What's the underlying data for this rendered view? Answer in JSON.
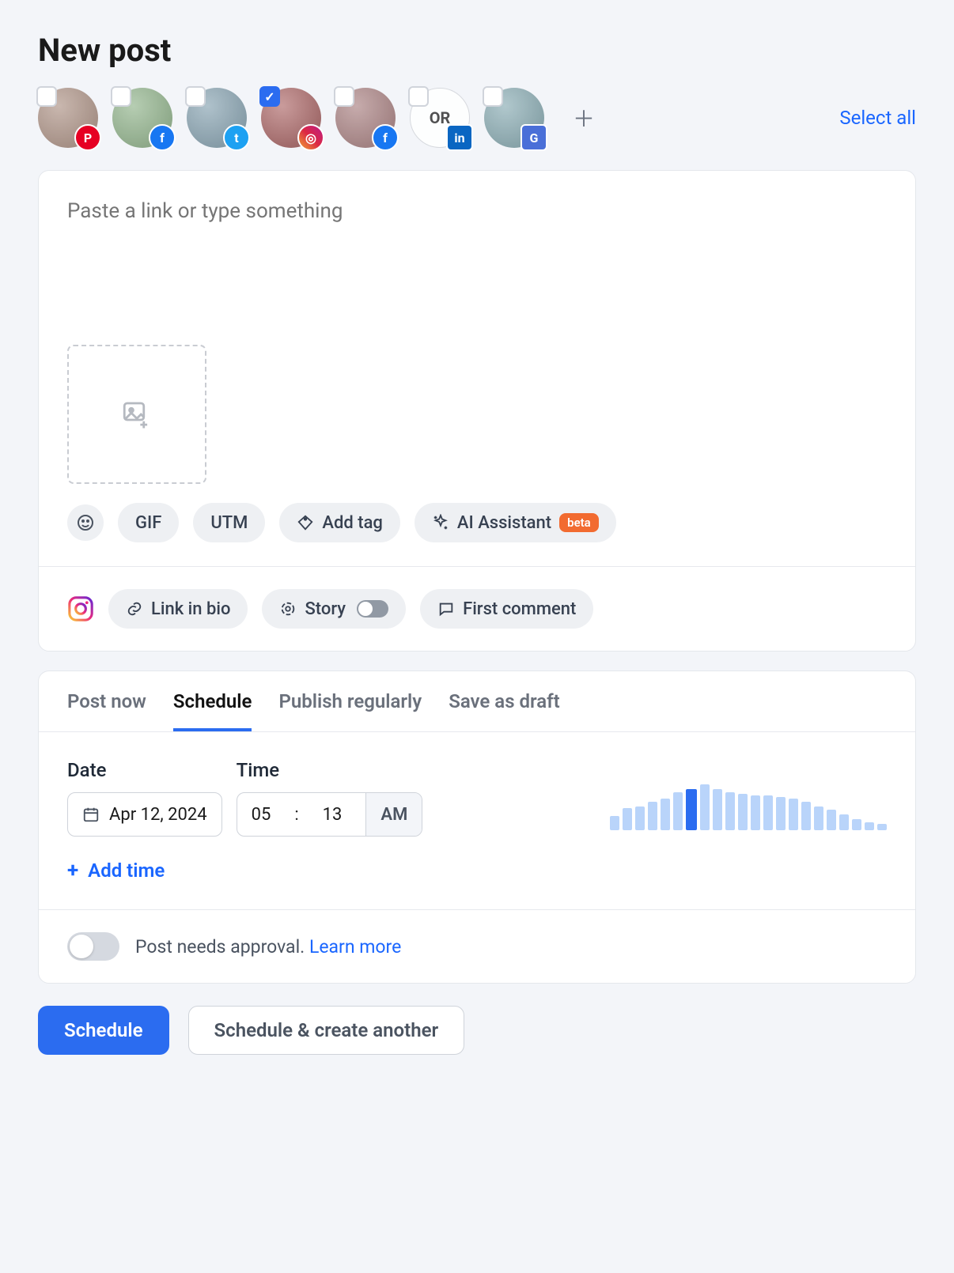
{
  "title": "New post",
  "select_all": "Select all",
  "accounts": [
    {
      "network": "pinterest",
      "checked": false,
      "avatar_hue": 20,
      "label": ""
    },
    {
      "network": "facebook",
      "checked": false,
      "avatar_hue": 110,
      "label": ""
    },
    {
      "network": "twitter",
      "checked": false,
      "avatar_hue": 200,
      "label": ""
    },
    {
      "network": "instagram",
      "checked": true,
      "avatar_hue": 0,
      "label": ""
    },
    {
      "network": "facebook",
      "checked": false,
      "avatar_hue": 0,
      "label": ""
    },
    {
      "network": "linkedin",
      "checked": false,
      "avatar_hue": 0,
      "label": "OR"
    },
    {
      "network": "google",
      "checked": false,
      "avatar_hue": 190,
      "label": ""
    }
  ],
  "composer": {
    "placeholder": "Paste a link or type something"
  },
  "toolbar": {
    "gif": "GIF",
    "utm": "UTM",
    "add_tag": "Add tag",
    "ai_assistant": "AI Assistant",
    "beta": "beta"
  },
  "ig_options": {
    "link_in_bio": "Link in bio",
    "story": "Story",
    "first_comment": "First comment"
  },
  "tabs": {
    "post_now": "Post now",
    "schedule": "Schedule",
    "publish_regularly": "Publish regularly",
    "save_draft": "Save as draft"
  },
  "schedule": {
    "date_label": "Date",
    "time_label": "Time",
    "date_value": "Apr 12, 2024",
    "hour": "05",
    "minute": "13",
    "ampm": "AM",
    "add_time": "Add time"
  },
  "histogram": [
    18,
    28,
    30,
    36,
    40,
    48,
    52,
    58,
    52,
    48,
    46,
    44,
    44,
    42,
    40,
    36,
    30,
    26,
    20,
    14,
    10,
    8
  ],
  "histogram_highlight_index": 6,
  "approval": {
    "text": "Post needs approval.",
    "link": "Learn more"
  },
  "footer": {
    "primary": "Schedule",
    "secondary": "Schedule & create another"
  },
  "network_glyph": {
    "pinterest": "P",
    "facebook": "f",
    "twitter": "t",
    "instagram": "◎",
    "linkedin": "in",
    "google": "G"
  }
}
